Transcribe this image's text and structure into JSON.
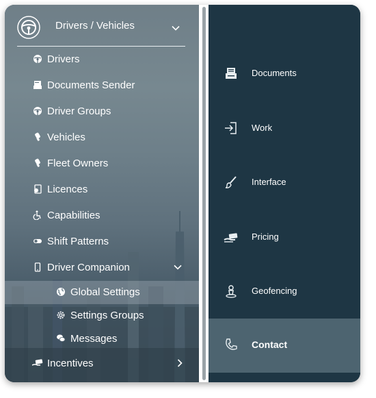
{
  "menu": {
    "title": "Drivers / Vehicles",
    "items": [
      {
        "label": "Drivers",
        "icon": "steering-wheel-icon"
      },
      {
        "label": "Documents Sender",
        "icon": "document-stack-icon"
      },
      {
        "label": "Driver Groups",
        "icon": "steering-wheel-icon"
      },
      {
        "label": "Vehicles",
        "icon": "car-key-icon"
      },
      {
        "label": "Fleet Owners",
        "icon": "car-key-icon"
      },
      {
        "label": "Licences",
        "icon": "license-icon"
      },
      {
        "label": "Capabilities",
        "icon": "wheelchair-icon"
      },
      {
        "label": "Shift Patterns",
        "icon": "toggle-icon"
      },
      {
        "label": "Driver Companion",
        "icon": "phone-icon"
      }
    ],
    "companion_sub": [
      {
        "label": "Global Settings",
        "icon": "globe-icon"
      },
      {
        "label": "Settings Groups",
        "icon": "gear-icon"
      },
      {
        "label": "Messages",
        "icon": "chat-bubbles-icon"
      }
    ],
    "incentives": {
      "label": "Incentives",
      "icon": "money-hand-icon"
    }
  },
  "settings_nav": {
    "items": [
      {
        "label": "Documents",
        "icon": "document-stack-icon"
      },
      {
        "label": "Work",
        "icon": "sign-in-icon"
      },
      {
        "label": "Interface",
        "icon": "paint-brush-icon"
      },
      {
        "label": "Pricing",
        "icon": "money-hand-icon"
      },
      {
        "label": "Geofencing",
        "icon": "location-person-icon"
      },
      {
        "label": "Contact",
        "icon": "phone-handset-icon"
      }
    ],
    "active": "Contact"
  },
  "colors": {
    "right_bg": "#1e3644",
    "active_bg": "#4d6470",
    "text": "#ffffff"
  }
}
